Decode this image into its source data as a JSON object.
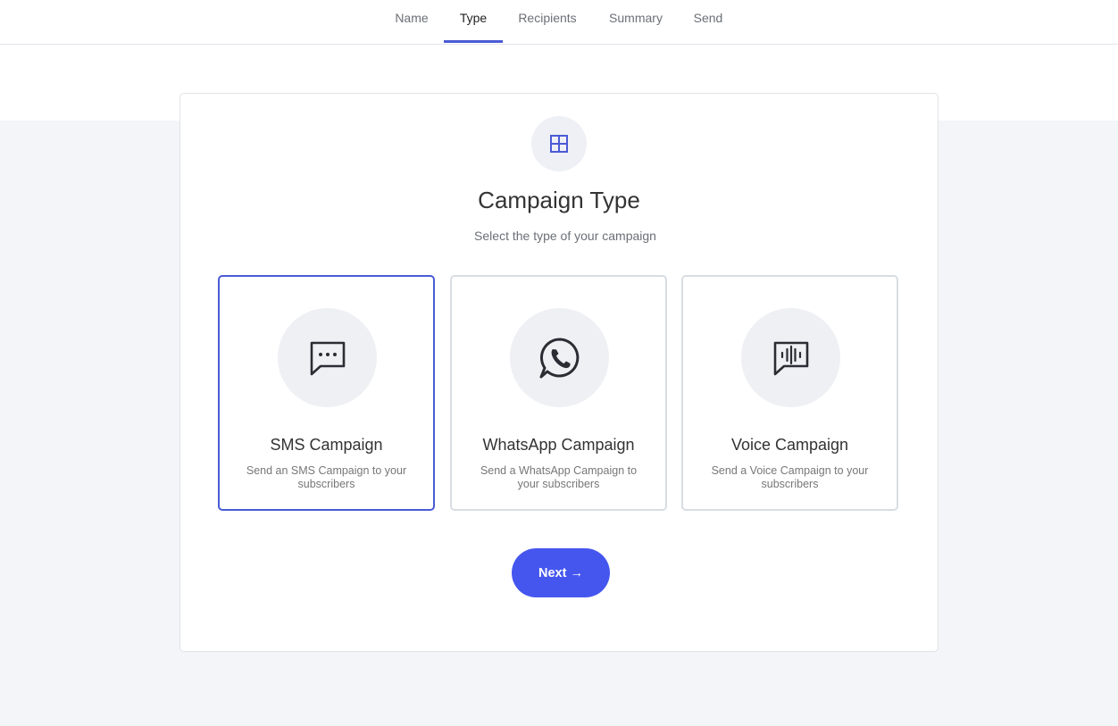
{
  "tabs": [
    {
      "label": "Name"
    },
    {
      "label": "Type"
    },
    {
      "label": "Recipients"
    },
    {
      "label": "Summary"
    },
    {
      "label": "Send"
    }
  ],
  "active_tab": "Type",
  "header": {
    "icon": "grid-icon",
    "title": "Campaign Type",
    "subtitle": "Select the type of your campaign"
  },
  "options": [
    {
      "title": "SMS Campaign",
      "description": "Send an SMS Campaign to your subscribers",
      "icon": "message-dots-icon",
      "selected": true
    },
    {
      "title": "WhatsApp Campaign",
      "description": "Send a WhatsApp Campaign to your subscribers",
      "icon": "whatsapp-icon",
      "selected": false
    },
    {
      "title": "Voice Campaign",
      "description": "Send a Voice Campaign to your subscribers",
      "icon": "voice-message-icon",
      "selected": false
    }
  ],
  "next_button": {
    "label": "Next →"
  },
  "colors": {
    "accent": "#4a5bd4",
    "button": "#4556ee",
    "icon_circle": "#eff0f4"
  }
}
